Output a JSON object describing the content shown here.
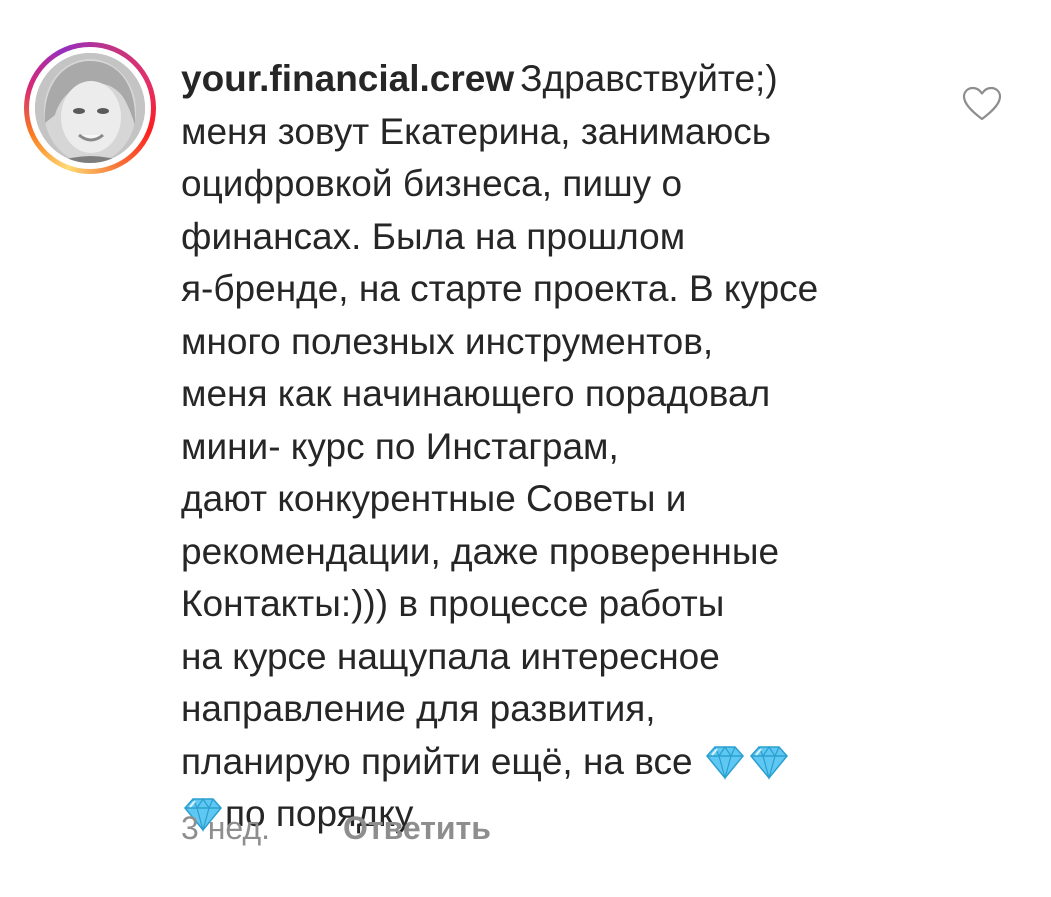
{
  "comment": {
    "username": "your.financial.crew",
    "lines": [
      "Здравствуйте;)",
      "меня зовут Екатерина, занимаюсь",
      "оцифровкой бизнеса, пишу о",
      "финансах. Была на прошлом",
      "я-бренде, на старте проекта. В курсе",
      "много полезных инструментов,",
      "меня как начинающего порадовал",
      "мини- курс по Инстаграм,",
      "дают конкурентные Советы и",
      "рекомендации, даже проверенные",
      "Контакты:))) в процессе работы",
      "на курсе нащупала интересное",
      "направление для развития,",
      "планирую прийти ещё, на все",
      "по порядку"
    ],
    "emoji": "gem-stone-icon",
    "timestamp": "3 нед.",
    "reply_label": "Ответить",
    "like_icon": "heart-outline-icon"
  },
  "colors": {
    "text": "#262626",
    "meta_text": "#8e8e8e",
    "gem": "#5ec8f2"
  }
}
